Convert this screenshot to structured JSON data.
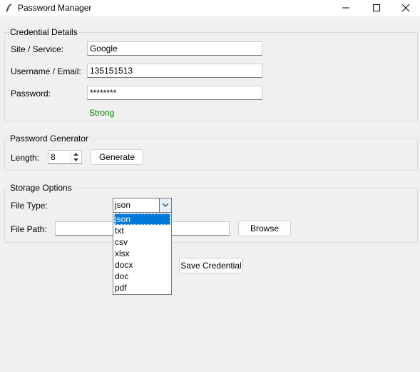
{
  "window": {
    "title": "Password Manager"
  },
  "credential": {
    "legend": "Credential Details",
    "site_label": "Site / Service:",
    "site_value": "Google",
    "username_label": "Username / Email:",
    "username_value": "135151513",
    "password_label": "Password:",
    "password_value": "********",
    "strength": "Strong",
    "strength_color": "#008000"
  },
  "generator": {
    "legend": "Password Generator",
    "length_label": "Length:",
    "length_value": "8",
    "generate_label": "Generate"
  },
  "storage": {
    "legend": "Storage Options",
    "filetype_label": "File Type:",
    "filetype_value": "json",
    "filepath_label": "File Path:",
    "filepath_value": "",
    "browse_label": "Browse",
    "options": [
      "json",
      "txt",
      "csv",
      "xlsx",
      "docx",
      "doc",
      "pdf"
    ],
    "selected_index": 0
  },
  "actions": {
    "save_label": "Save Credential"
  },
  "colors": {
    "selection": "#0078d7",
    "background": "#f0f0f0"
  }
}
